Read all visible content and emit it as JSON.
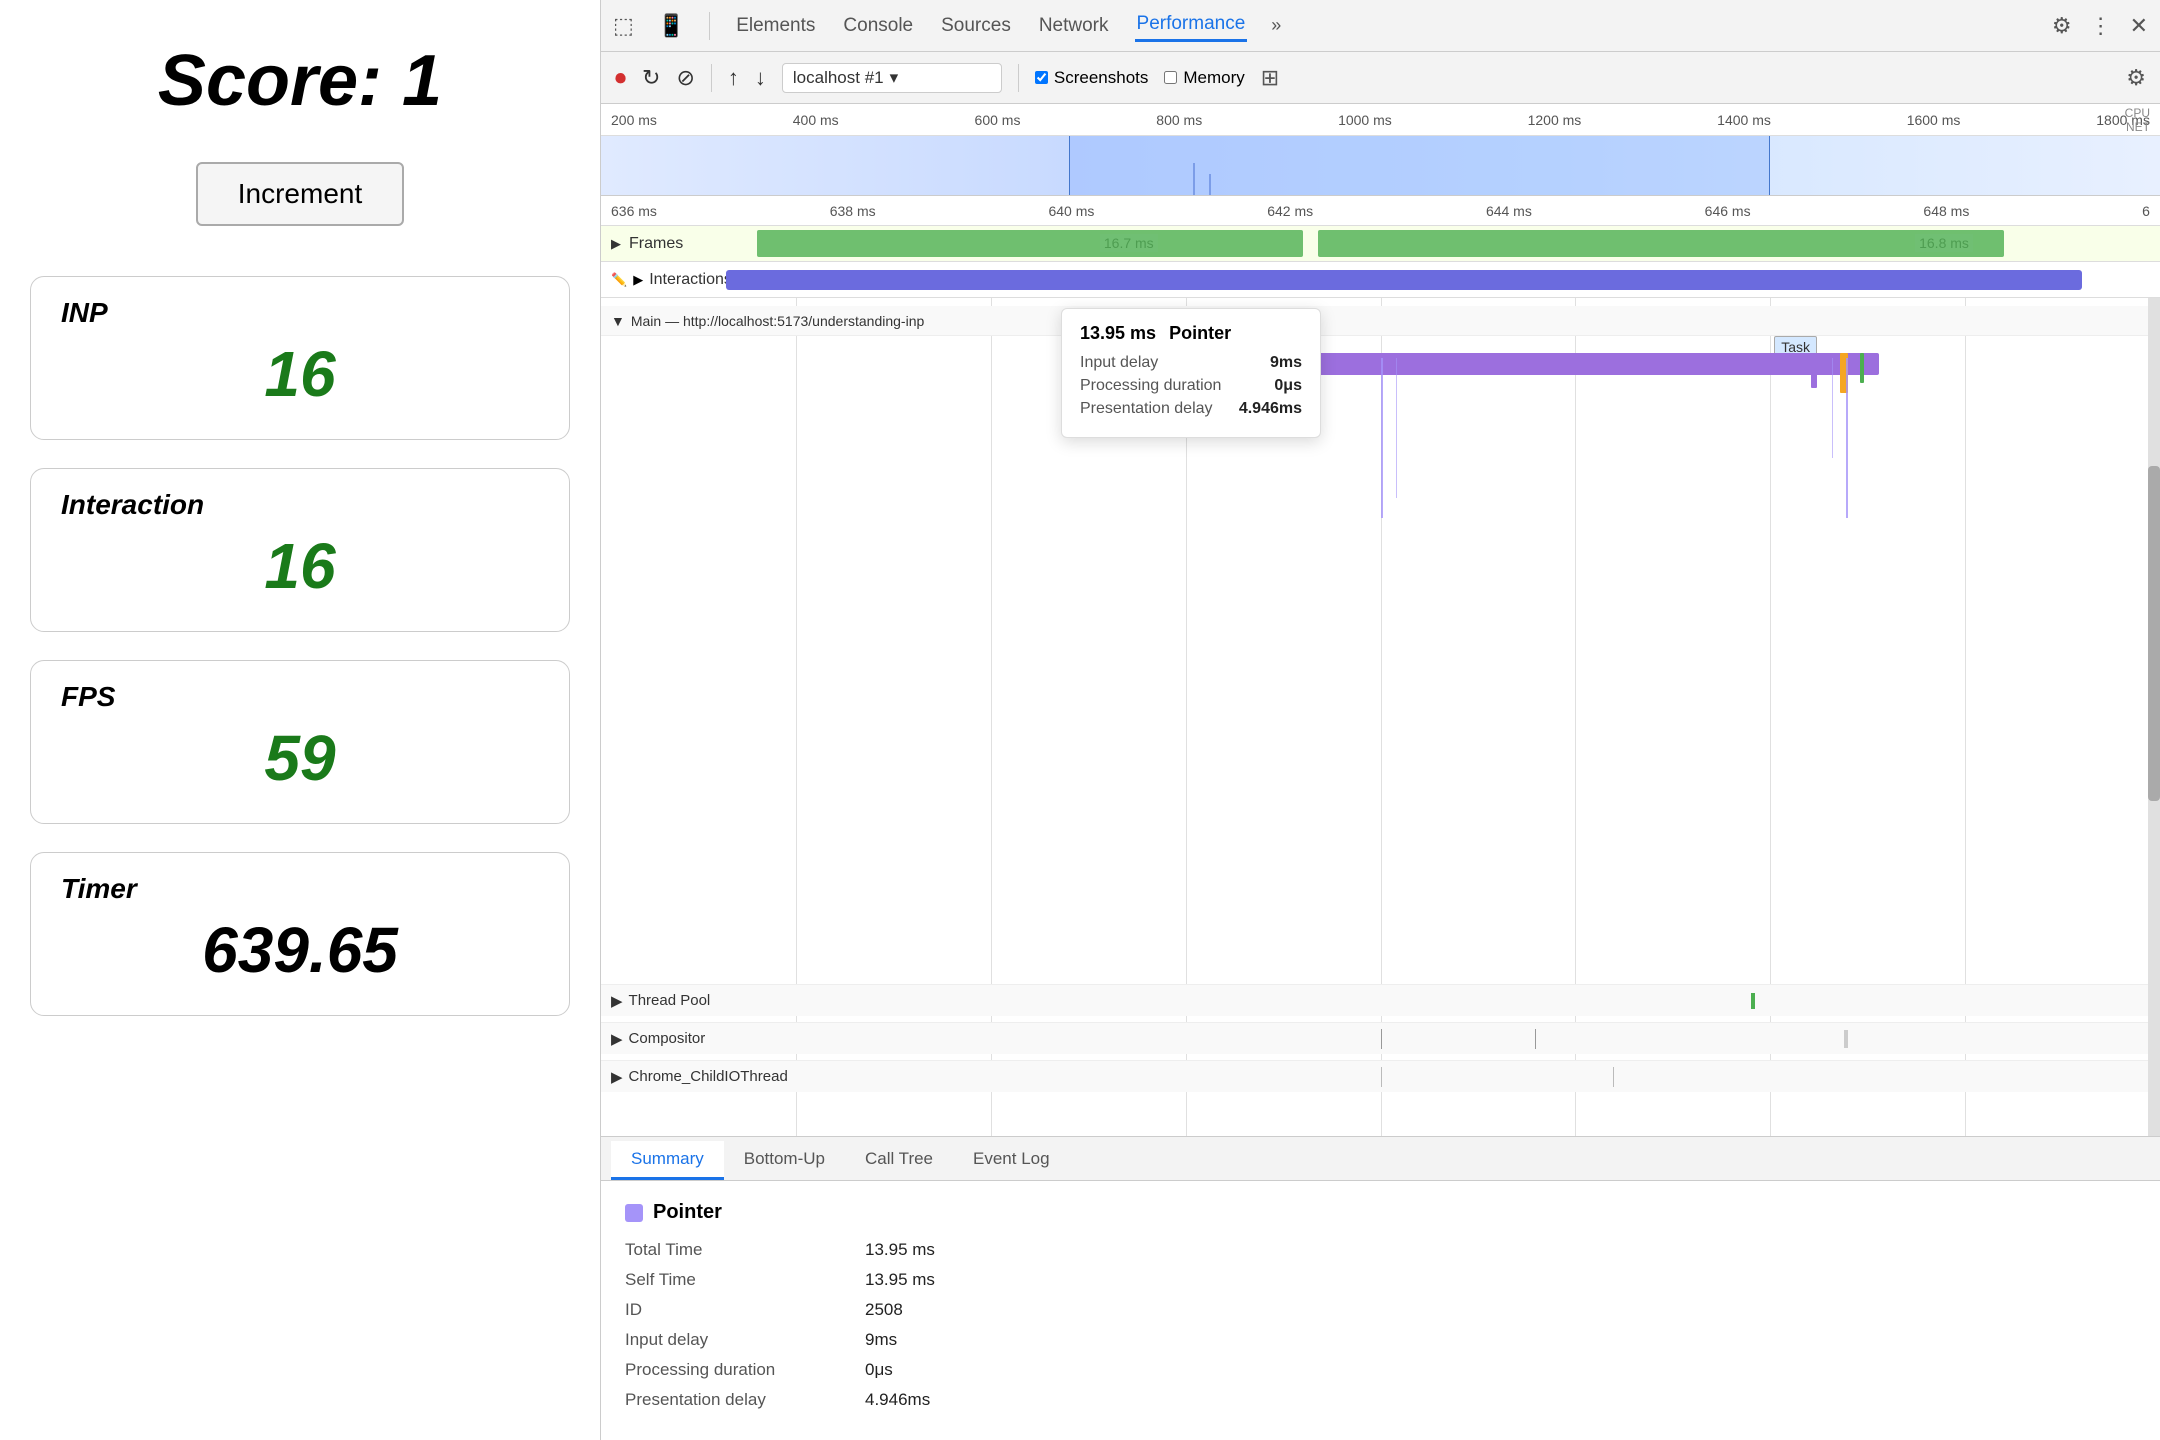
{
  "left": {
    "score_label": "Score:",
    "score_value": "1",
    "increment_button": "Increment",
    "metrics": [
      {
        "id": "inp",
        "label": "INP",
        "value": "16",
        "black": false
      },
      {
        "id": "interaction",
        "label": "Interaction",
        "value": "16",
        "black": false
      },
      {
        "id": "fps",
        "label": "FPS",
        "value": "59",
        "black": false
      },
      {
        "id": "timer",
        "label": "Timer",
        "value": "639.65",
        "black": true
      }
    ]
  },
  "devtools": {
    "tabs": [
      "Elements",
      "Console",
      "Sources",
      "Network",
      "Performance"
    ],
    "active_tab": "Performance",
    "record_url": "localhost #1",
    "screenshots_label": "Screenshots",
    "memory_label": "Memory",
    "ruler_labels": [
      "200 ms",
      "400 ms",
      "600 ms",
      "800 ms",
      "1000 ms",
      "1200 ms",
      "1400 ms",
      "1600 ms",
      "1800 ms"
    ],
    "cpu_label": "CPU",
    "net_label": "NET",
    "zoom_labels": [
      "636 ms",
      "638 ms",
      "640 ms",
      "642 ms",
      "644 ms",
      "646 ms",
      "648 ms",
      "6"
    ],
    "frames_label": "Frames",
    "frame_time1": "16.7 ms",
    "frame_time2": "16.8 ms",
    "interactions_label": "Interactions",
    "main_thread_url": "Main — http://localhost:5173/understanding-inp",
    "thread_pool_label": "Thread Pool",
    "compositor_label": "Compositor",
    "chrome_io_label": "Chrome_ChildIOThread",
    "tooltip": {
      "time": "13.95 ms",
      "type": "Pointer",
      "input_delay_label": "Input delay",
      "input_delay_val": "9ms",
      "processing_label": "Processing duration",
      "processing_val": "0μs",
      "presentation_label": "Presentation delay",
      "presentation_val": "4.946ms"
    },
    "bottom_tabs": [
      "Summary",
      "Bottom-Up",
      "Call Tree",
      "Event Log"
    ],
    "active_bottom_tab": "Summary",
    "summary": {
      "color": "#a594f9",
      "title": "Pointer",
      "rows": [
        {
          "key": "Total Time",
          "val": "13.95 ms"
        },
        {
          "key": "Self Time",
          "val": "13.95 ms"
        },
        {
          "key": "ID",
          "val": "2508"
        },
        {
          "key": "Input delay",
          "val": "9ms"
        },
        {
          "key": "Processing duration",
          "val": "0μs"
        },
        {
          "key": "Presentation delay",
          "val": "4.946ms"
        }
      ]
    }
  }
}
